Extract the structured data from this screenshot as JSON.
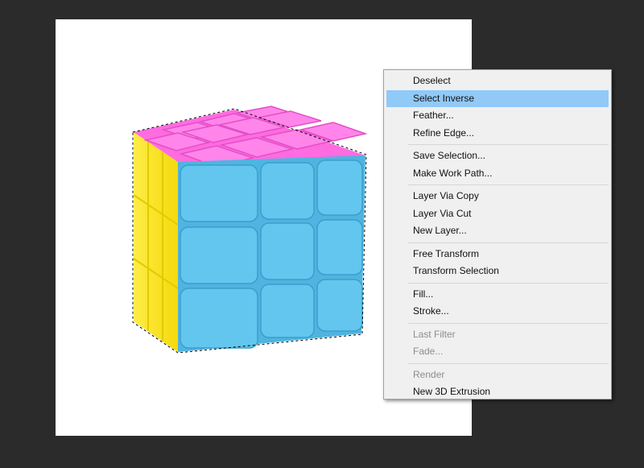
{
  "context_menu": {
    "groups": [
      [
        {
          "label": "Deselect",
          "state": "normal"
        },
        {
          "label": "Select Inverse",
          "state": "selected"
        },
        {
          "label": "Feather...",
          "state": "normal"
        },
        {
          "label": "Refine Edge...",
          "state": "normal"
        }
      ],
      [
        {
          "label": "Save Selection...",
          "state": "normal"
        },
        {
          "label": "Make Work Path...",
          "state": "normal"
        }
      ],
      [
        {
          "label": "Layer Via Copy",
          "state": "normal"
        },
        {
          "label": "Layer Via Cut",
          "state": "normal"
        },
        {
          "label": "New Layer...",
          "state": "normal"
        }
      ],
      [
        {
          "label": "Free Transform",
          "state": "normal"
        },
        {
          "label": "Transform Selection",
          "state": "normal"
        }
      ],
      [
        {
          "label": "Fill...",
          "state": "normal"
        },
        {
          "label": "Stroke...",
          "state": "normal"
        }
      ],
      [
        {
          "label": "Last Filter",
          "state": "disabled"
        },
        {
          "label": "Fade...",
          "state": "disabled"
        }
      ],
      [
        {
          "label": "Render",
          "state": "disabled"
        },
        {
          "label": "New 3D Extrusion",
          "state": "normal"
        }
      ]
    ]
  },
  "colors": {
    "workspace": "#2b2b2b",
    "canvas": "#ffffff",
    "menu_bg": "#f0f0f0",
    "highlight": "#91c9f7",
    "cube_top": "#ff6ee0",
    "cube_front": "#5fc3ea",
    "cube_side": "#ffee1a"
  },
  "canvas": {
    "image_subject": "rubiks-cube-selection",
    "selection": "marching-ants"
  }
}
